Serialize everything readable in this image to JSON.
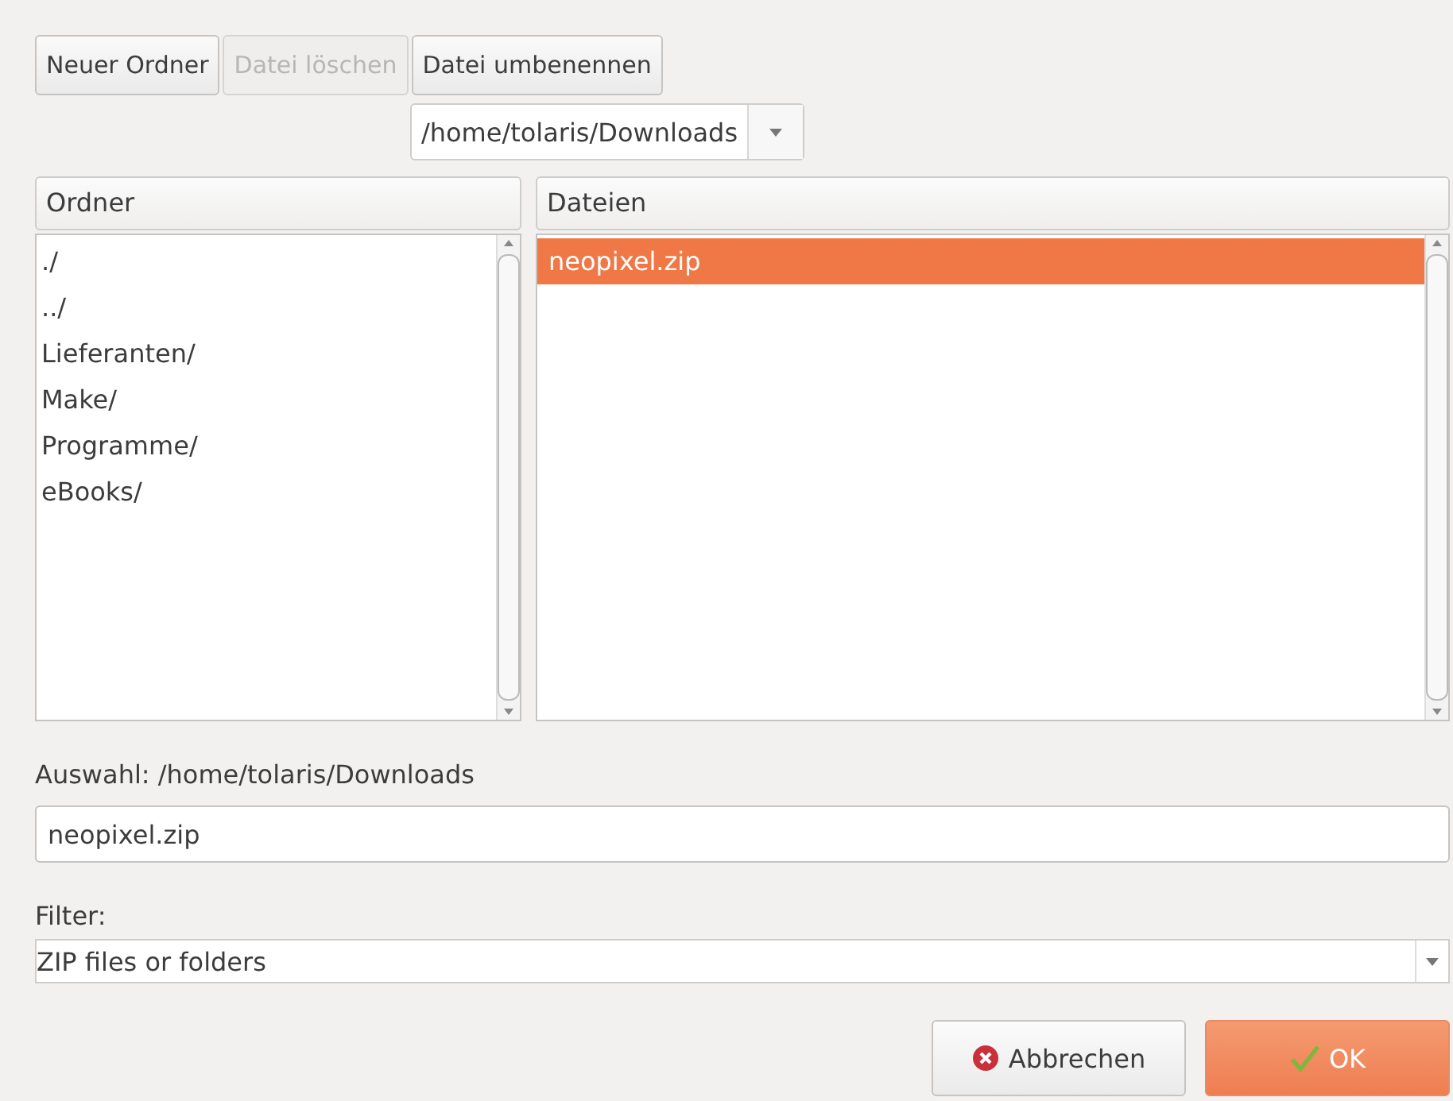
{
  "toolbar": [
    {
      "label": "Neuer Ordner",
      "disabled": false
    },
    {
      "label": "Datei löschen",
      "disabled": true
    },
    {
      "label": "Datei umbenennen",
      "disabled": false
    }
  ],
  "path_combo": {
    "value": "/home/tolaris/Downloads"
  },
  "folders": {
    "header": "Ordner",
    "items": [
      {
        "label": "./",
        "selected": false
      },
      {
        "label": "../",
        "selected": false
      },
      {
        "label": "Lieferanten/",
        "selected": false
      },
      {
        "label": "Make/",
        "selected": false
      },
      {
        "label": "Programme/",
        "selected": false
      },
      {
        "label": "eBooks/",
        "selected": false
      }
    ]
  },
  "files": {
    "header": "Dateien",
    "items": [
      {
        "label": "neopixel.zip",
        "selected": true
      }
    ]
  },
  "selection": {
    "label": "Auswahl: /home/tolaris/Downloads",
    "value": "neopixel.zip"
  },
  "filter": {
    "label": "Filter:",
    "value": "ZIP files or folders"
  },
  "buttons": [
    {
      "label": "Abbrechen",
      "kind": "cancel"
    },
    {
      "label": "OK",
      "kind": "ok"
    }
  ]
}
